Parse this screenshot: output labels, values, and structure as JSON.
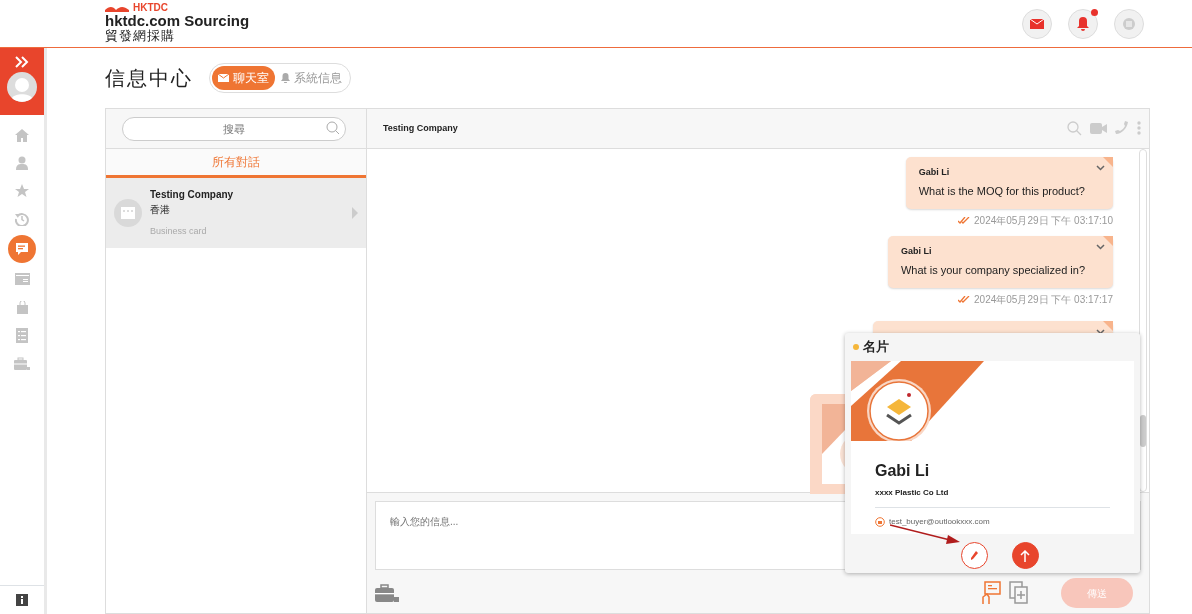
{
  "header": {
    "logo_mark": "HKTDC",
    "brand": "hktdc.com Sourcing",
    "brand_sub": "貿發網採購",
    "notification_unread": true
  },
  "sidebar": {
    "items": [
      {
        "kind": "home",
        "selected": false
      },
      {
        "kind": "user",
        "selected": false
      },
      {
        "kind": "star",
        "selected": false
      },
      {
        "kind": "history",
        "selected": false
      },
      {
        "kind": "chat",
        "selected": true
      },
      {
        "kind": "card",
        "selected": false
      },
      {
        "kind": "bag",
        "selected": false
      },
      {
        "kind": "checklist",
        "selected": false
      },
      {
        "kind": "briefcase",
        "selected": false
      }
    ]
  },
  "page_title": "信息中心",
  "tabs": [
    {
      "label": "聊天室",
      "kind": "mail",
      "selected": true
    },
    {
      "label": "系統信息",
      "kind": "bell",
      "selected": false
    }
  ],
  "conversation_list": {
    "search_placeholder": "搜尋",
    "filter_tab": "所有對話",
    "items": [
      {
        "name": "Testing Company",
        "location": "香港",
        "preview": "Business card",
        "selected": true
      }
    ]
  },
  "chat": {
    "title": "Testing Company",
    "messages": [
      {
        "sender": "Gabi Li",
        "text": "What is the MOQ for this product?",
        "time": "2024年05月29日 下午 03:17:10",
        "read": true
      },
      {
        "sender": "Gabi Li",
        "text": "What is your company specialized in?",
        "time": "2024年05月29日 下午 03:17:17",
        "read": true
      }
    ],
    "input_placeholder": "輸入您的信息...",
    "send_label": "傳送",
    "send_disabled": true
  },
  "business_card_popup": {
    "title": "名片",
    "name": "Gabi Li",
    "company": "xxxx Plastic Co Ltd",
    "email": "test_buyer@outlookxxx.com"
  }
}
